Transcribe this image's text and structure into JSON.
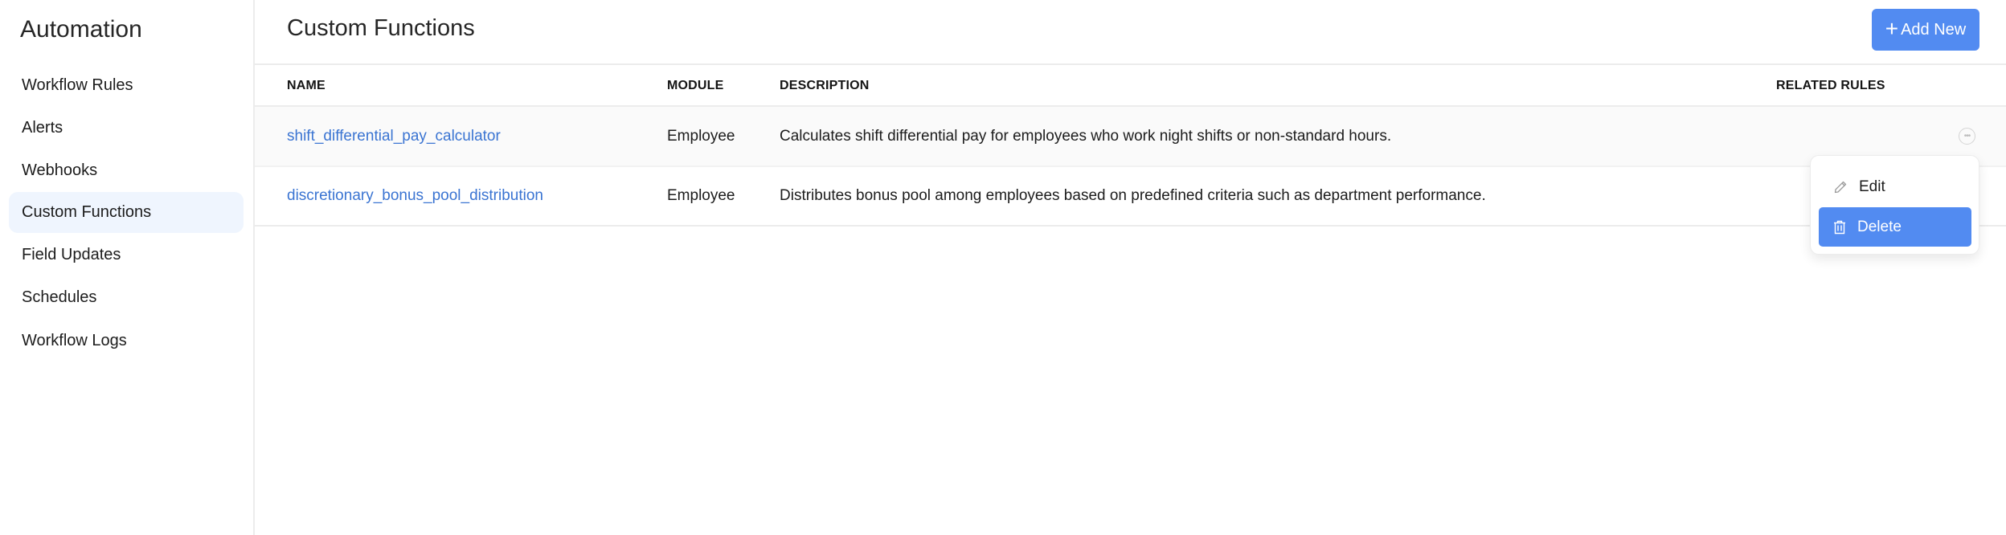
{
  "sidebar": {
    "title": "Automation",
    "items": [
      {
        "label": "Workflow Rules",
        "active": false
      },
      {
        "label": "Alerts",
        "active": false
      },
      {
        "label": "Webhooks",
        "active": false
      },
      {
        "label": "Custom Functions",
        "active": true
      },
      {
        "label": "Field Updates",
        "active": false
      },
      {
        "label": "Schedules",
        "active": false
      },
      {
        "label": "Workflow Logs",
        "active": false
      }
    ]
  },
  "header": {
    "title": "Custom Functions",
    "add_button_icon": "plus-icon",
    "add_button_label": "Add New"
  },
  "table": {
    "columns": [
      "NAME",
      "MODULE",
      "DESCRIPTION",
      "RELATED RULES"
    ],
    "rows": [
      {
        "name": "shift_differential_pay_calculator",
        "module": "Employee",
        "description": "Calculates shift differential pay for employees who work night shifts or non-standard hours.",
        "related_rules": ""
      },
      {
        "name": "discretionary_bonus_pool_distribution",
        "module": "Employee",
        "description": "Distributes bonus pool among employees based on predefined criteria such as department performance.",
        "related_rules": ""
      }
    ]
  },
  "row_actions": {
    "more_icon": "ellipsis-icon",
    "menu": [
      {
        "label": "Edit",
        "icon": "pencil-icon",
        "highlighted": false
      },
      {
        "label": "Delete",
        "icon": "trash-icon",
        "highlighted": true
      }
    ]
  },
  "colors": {
    "accent": "#528bf1",
    "link": "#3a74d2",
    "active_nav_bg": "#eff5fe",
    "hover_row_bg": "#fafafa"
  }
}
